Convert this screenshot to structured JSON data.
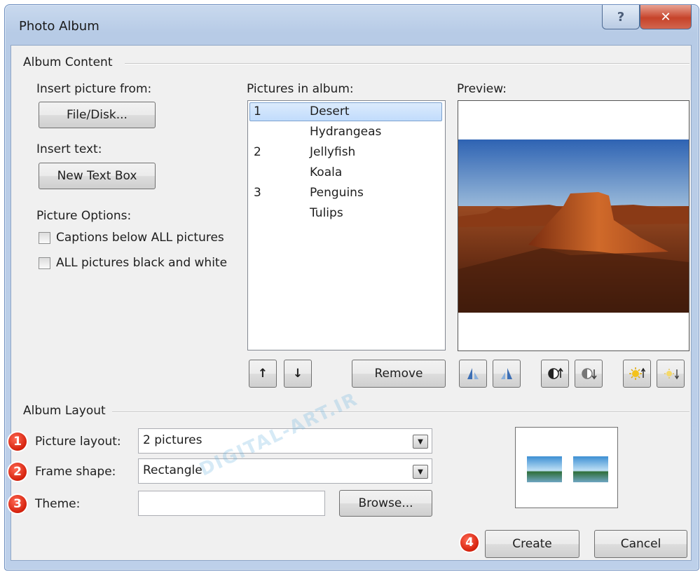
{
  "window": {
    "title": "Photo Album",
    "help": "?",
    "close": "✕"
  },
  "album_content": {
    "group_label": "Album Content",
    "insert_picture_label": "Insert picture from:",
    "file_disk_button": "File/Disk...",
    "insert_text_label": "Insert text:",
    "new_text_box_button": "New Text Box",
    "picture_options_label": "Picture Options:",
    "options": [
      {
        "label": "Captions below ALL pictures",
        "checked": false
      },
      {
        "label": "ALL pictures black and white",
        "checked": false
      }
    ],
    "pictures_label": "Pictures in album:",
    "pictures": [
      {
        "num": "1",
        "name": "Desert",
        "selected": true
      },
      {
        "num": "",
        "name": "Hydrangeas",
        "selected": false
      },
      {
        "num": "2",
        "name": "Jellyfish",
        "selected": false
      },
      {
        "num": "",
        "name": "Koala",
        "selected": false
      },
      {
        "num": "3",
        "name": "Penguins",
        "selected": false
      },
      {
        "num": "",
        "name": "Tulips",
        "selected": false
      }
    ],
    "preview_label": "Preview:",
    "move_up_glyph": "↑",
    "move_down_glyph": "↓",
    "remove_button": "Remove",
    "tools": [
      {
        "icon": "rotate-left-icon"
      },
      {
        "icon": "rotate-right-icon"
      },
      {
        "icon": "contrast-up-icon"
      },
      {
        "icon": "contrast-down-icon"
      },
      {
        "icon": "brightness-up-icon"
      },
      {
        "icon": "brightness-down-icon"
      }
    ]
  },
  "album_layout": {
    "group_label": "Album Layout",
    "picture_layout_label": "Picture layout:",
    "picture_layout_value": "2 pictures",
    "frame_shape_label": "Frame shape:",
    "frame_shape_value": "Rectangle",
    "theme_label": "Theme:",
    "theme_value": "",
    "browse_button": "Browse..."
  },
  "footer": {
    "create_button": "Create",
    "cancel_button": "Cancel"
  },
  "badges": [
    "1",
    "2",
    "3",
    "4"
  ],
  "watermark": "DIGITAL-ART.IR"
}
